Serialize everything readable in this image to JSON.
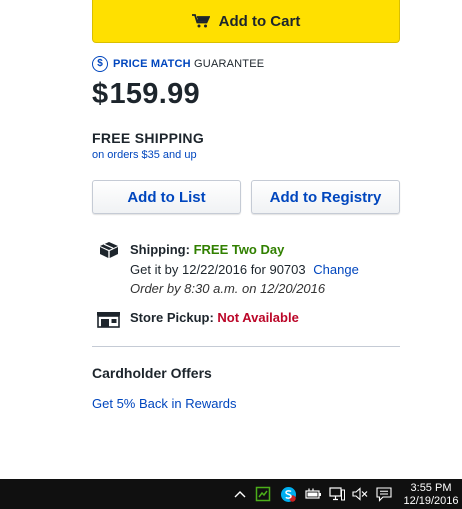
{
  "product": {
    "add_to_cart_label": "Add to Cart",
    "price_match": {
      "bold": "PRICE MATCH",
      "rest": "GUARANTEE",
      "icon_glyph": "$"
    },
    "price": {
      "currency": "$",
      "amount": "159.99"
    },
    "shipping": {
      "title": "FREE SHIPPING",
      "subtitle": "on orders $35 and up"
    },
    "add_to_list_label": "Add to List",
    "add_to_registry_label": "Add to Registry"
  },
  "fulfillment": {
    "shipping": {
      "label": "Shipping:",
      "status": "FREE Two Day",
      "delivery_text": "Get it by 12/22/2016 for 90703",
      "change_label": "Change",
      "order_by": "Order by 8:30 a.m. on 12/20/2016"
    },
    "pickup": {
      "label": "Store Pickup:",
      "status": "Not Available"
    }
  },
  "offers": {
    "title": "Cardholder Offers",
    "reward_link": "Get 5% Back in Rewards"
  },
  "taskbar": {
    "time": "3:55 PM",
    "date": "12/19/2016"
  },
  "colors": {
    "accent_blue": "#0046be",
    "cart_yellow": "#ffe000",
    "available_green": "#318000",
    "unavailable_red": "#bb0628",
    "taskbar_bg": "#101010"
  },
  "icons": {
    "cart": "cart-icon",
    "price_match": "dollar-circle-icon",
    "shipping": "package-icon",
    "pickup": "store-icon",
    "tray": [
      "chevron-up-icon",
      "app-tray-icon",
      "skype-icon",
      "battery-icon",
      "network-icon",
      "volume-muted-icon",
      "notification-icon"
    ]
  }
}
